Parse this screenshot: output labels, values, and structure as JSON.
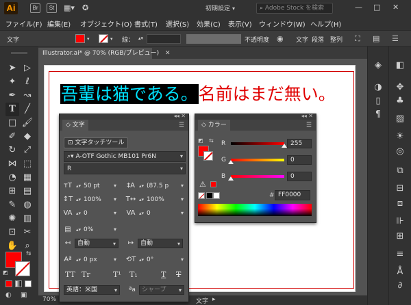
{
  "app": {
    "logo": "Ai",
    "shortcut_icons": [
      "Br",
      "St"
    ],
    "workspace": "初期設定",
    "stock_search_placeholder": "Adobe Stock を検索"
  },
  "menu": [
    "ファイル(F)",
    "編集(E)",
    "オブジェクト(O)",
    "書式(T)",
    "選択(S)",
    "効果(C)",
    "表示(V)",
    "ウィンドウ(W)",
    "ヘルプ(H)"
  ],
  "control_bar": {
    "label": "文字",
    "stroke_label": "線：",
    "opacity_label": "不透明度",
    "links": [
      "文字",
      "段落",
      "整列"
    ]
  },
  "document": {
    "tab_title": "Illustrator.ai* @ 70% (RGB/プレビュー)",
    "sample_selected": "吾輩は猫である。",
    "sample_rest": "名前はまだ無い。"
  },
  "status_bar": {
    "zoom": "70%",
    "artboard": "1",
    "mode": "文字"
  },
  "character_panel": {
    "tab": "文字",
    "touch_tool_label": "文字タッチツール",
    "font_family": "A-OTF Gothic MB101 Pr6N",
    "font_style": "R",
    "font_size": "50 pt",
    "leading": "(87.5 p",
    "vertical_scale": "100%",
    "horizontal_scale": "100%",
    "kerning": "0",
    "tracking": "0",
    "tsume": "0%",
    "mojikumi_before": "自動",
    "mojikumi_after": "自動",
    "baseline_shift": "0 px",
    "rotation": "0°",
    "language": "英語：米国",
    "antialias": "シャープ",
    "tt_buttons": [
      "TT",
      "Tr",
      "T¹",
      "T₁",
      "T",
      "T"
    ]
  },
  "color_panel": {
    "tab": "カラー",
    "r_label": "R",
    "g_label": "G",
    "b_label": "B",
    "r": "255",
    "g": "0",
    "b": "0",
    "r_fraction": 1.0,
    "g_fraction": 0.0,
    "b_fraction": 0.0,
    "hash": "#",
    "hex": "FF0000"
  },
  "colors": {
    "fill": "#ff0000",
    "selection_text": "#00e4ff",
    "unselected_text": "#e00000"
  }
}
